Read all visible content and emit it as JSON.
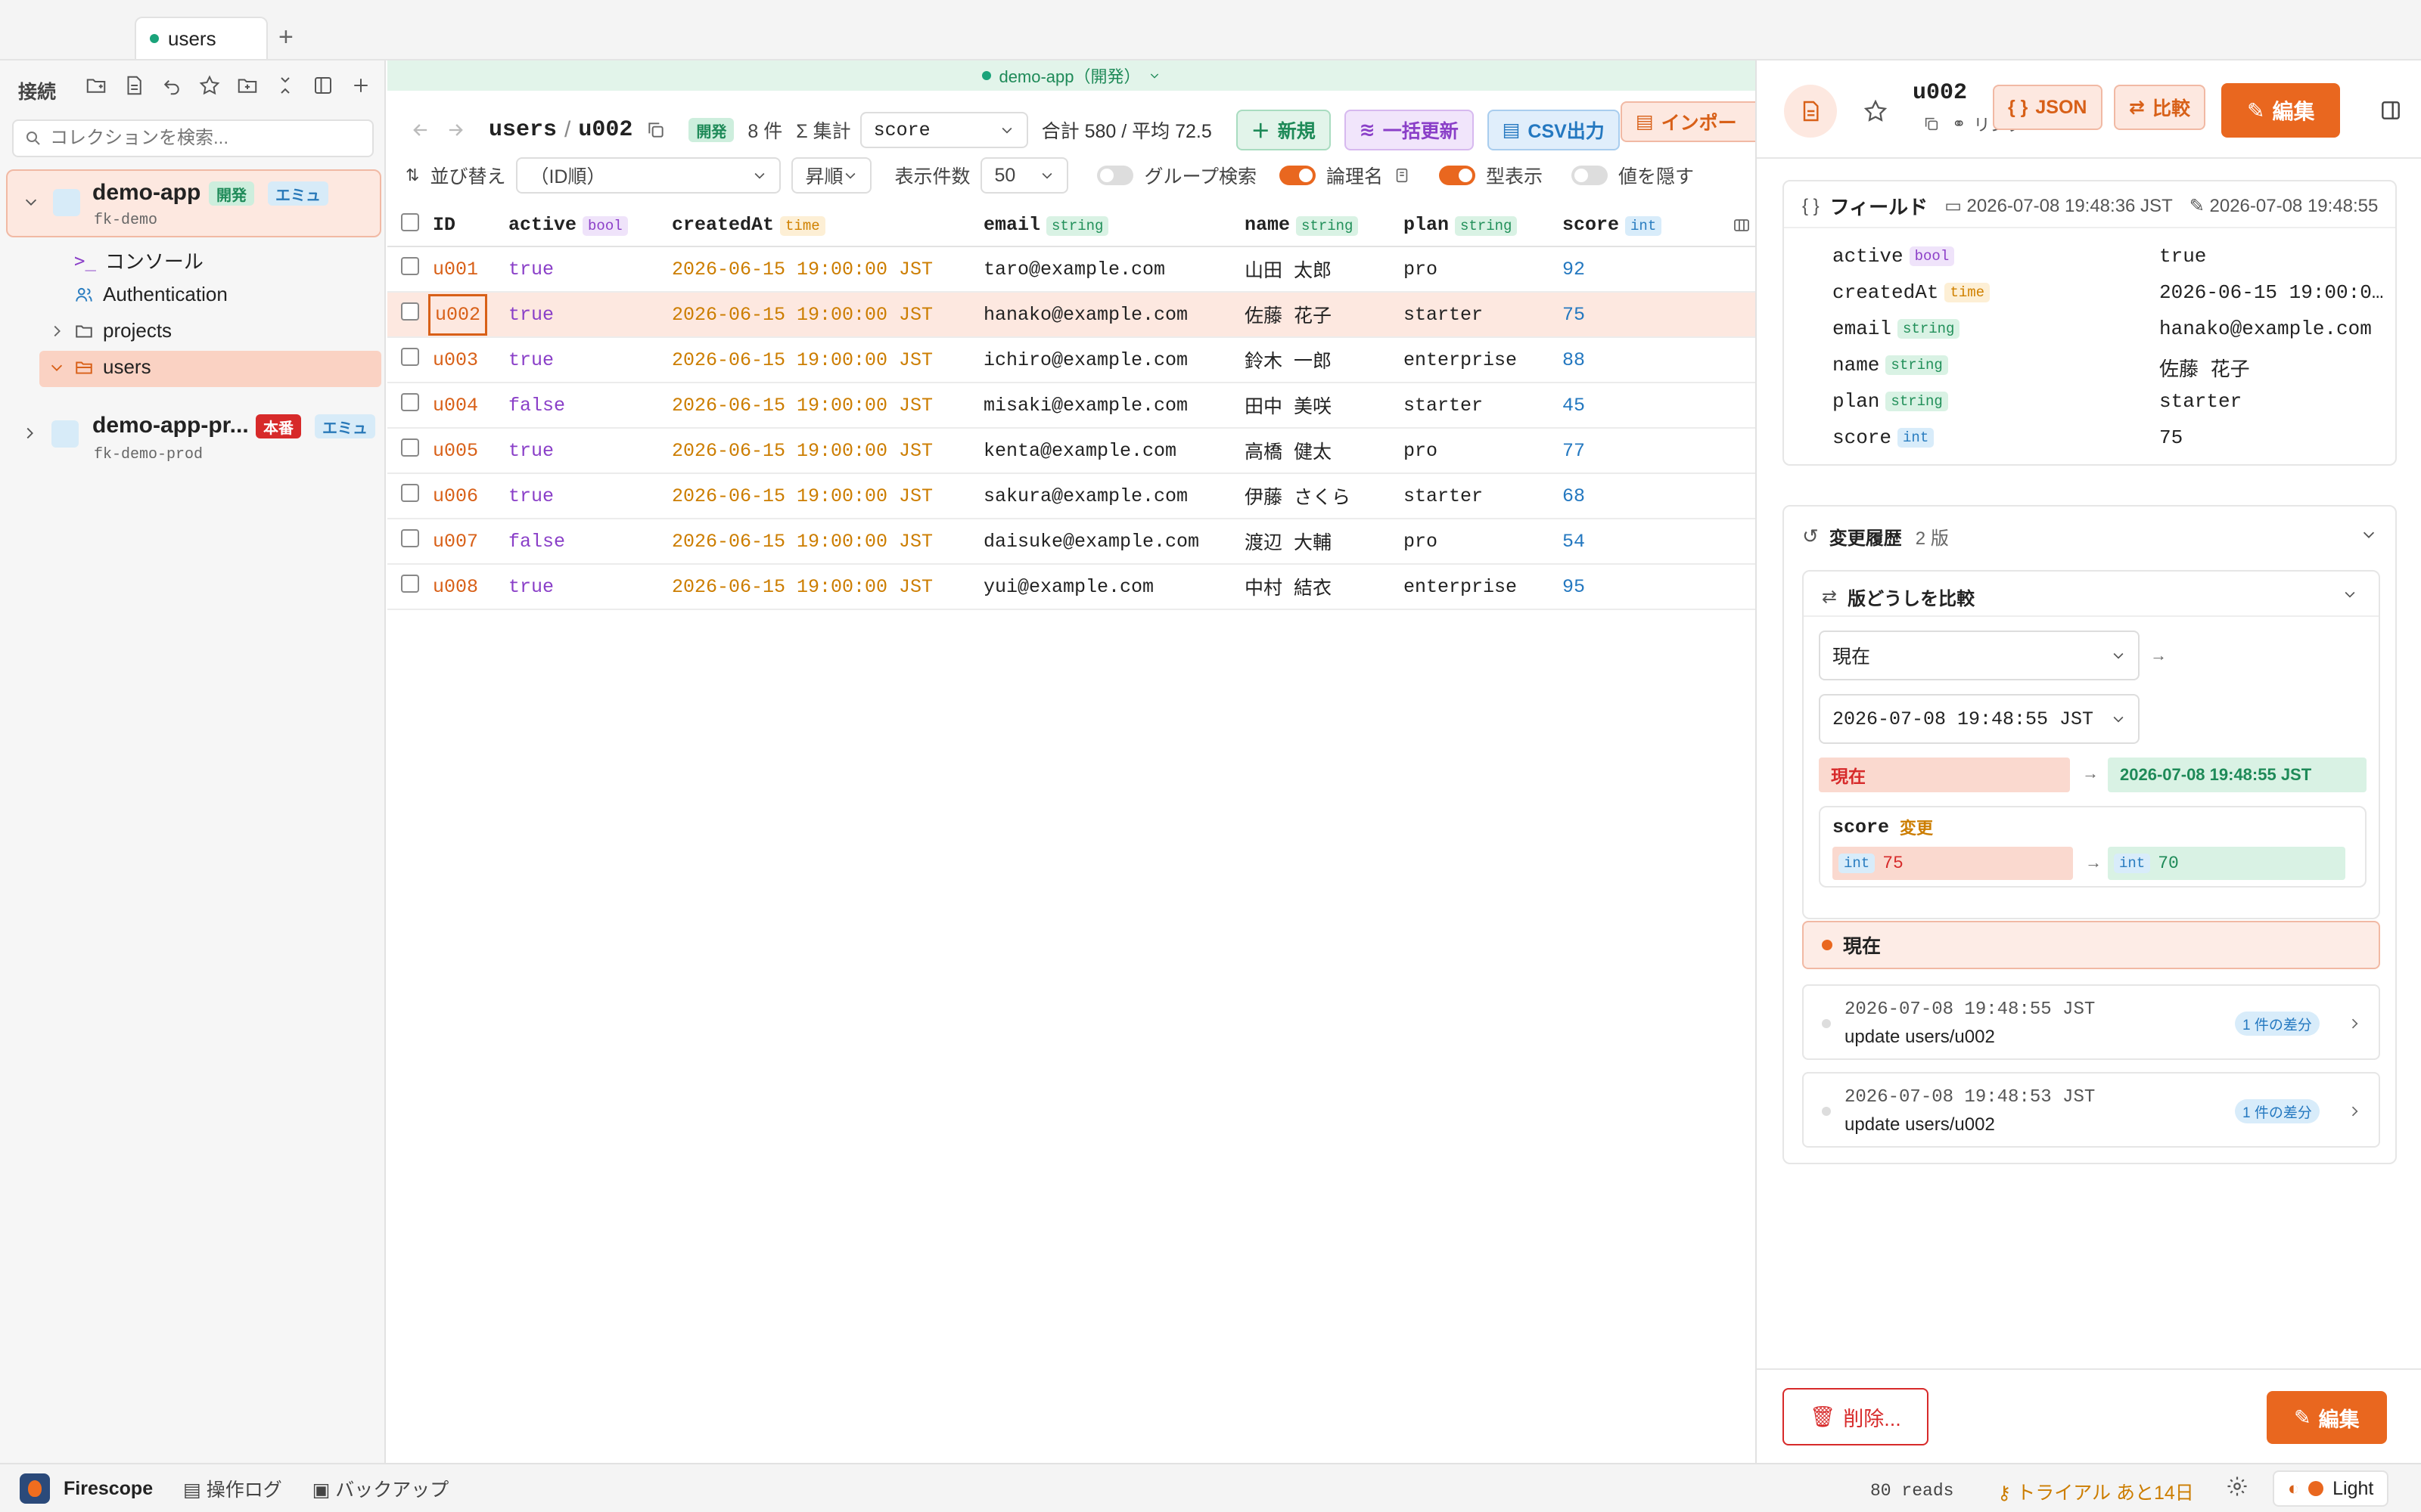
{
  "tabs": [
    {
      "label": "users"
    }
  ],
  "sidebar": {
    "title": "接続",
    "search_placeholder": "コレクションを検索...",
    "connections": [
      {
        "name": "demo-app",
        "project": "fk-demo",
        "env": "開発",
        "mode": "エミュ",
        "children": [
          {
            "label": "コンソール"
          },
          {
            "label": "Authentication"
          },
          {
            "label": "projects"
          },
          {
            "label": "users"
          }
        ]
      },
      {
        "name": "demo-app-pr...",
        "project": "fk-demo-prod",
        "env": "本番",
        "mode": "エミュ"
      }
    ]
  },
  "env_banner": "demo-app（開発）",
  "toolbar": {
    "path_collection": "users",
    "path_sep": "/",
    "path_doc": "u002",
    "env_badge": "開発",
    "count": "8 件",
    "agg_label": "集計",
    "agg_field": "score",
    "agg_result": "合計 580 / 平均 72.5",
    "new_label": "新規",
    "bulk_label": "一括更新",
    "csv_label": "CSV出力",
    "import_label": "インポー"
  },
  "filterbar": {
    "sort_label": "並び替え",
    "sort_value": "（ID順）",
    "order_value": "昇順",
    "page_size_label": "表示件数",
    "page_size": "50",
    "group_search_label": "グループ検索",
    "group_search": false,
    "logical_name_label": "論理名",
    "logical_name": true,
    "type_display_label": "型表示",
    "type_display": true,
    "hide_values_label": "値を隠す",
    "hide_values": false
  },
  "table": {
    "columns": [
      {
        "name": "ID",
        "type": ""
      },
      {
        "name": "active",
        "type": "bool"
      },
      {
        "name": "createdAt",
        "type": "time"
      },
      {
        "name": "email",
        "type": "string"
      },
      {
        "name": "name",
        "type": "string"
      },
      {
        "name": "plan",
        "type": "string"
      },
      {
        "name": "score",
        "type": "int"
      }
    ],
    "rows": [
      {
        "id": "u001",
        "active": "true",
        "createdAt": "2026-06-15 19:00:00 JST",
        "email": "taro@example.com",
        "name": "山田 太郎",
        "plan": "pro",
        "score": "92"
      },
      {
        "id": "u002",
        "active": "true",
        "createdAt": "2026-06-15 19:00:00 JST",
        "email": "hanako@example.com",
        "name": "佐藤 花子",
        "plan": "starter",
        "score": "75"
      },
      {
        "id": "u003",
        "active": "true",
        "createdAt": "2026-06-15 19:00:00 JST",
        "email": "ichiro@example.com",
        "name": "鈴木 一郎",
        "plan": "enterprise",
        "score": "88"
      },
      {
        "id": "u004",
        "active": "false",
        "createdAt": "2026-06-15 19:00:00 JST",
        "email": "misaki@example.com",
        "name": "田中 美咲",
        "plan": "starter",
        "score": "45"
      },
      {
        "id": "u005",
        "active": "true",
        "createdAt": "2026-06-15 19:00:00 JST",
        "email": "kenta@example.com",
        "name": "高橋 健太",
        "plan": "pro",
        "score": "77"
      },
      {
        "id": "u006",
        "active": "true",
        "createdAt": "2026-06-15 19:00:00 JST",
        "email": "sakura@example.com",
        "name": "伊藤 さくら",
        "plan": "starter",
        "score": "68"
      },
      {
        "id": "u007",
        "active": "false",
        "createdAt": "2026-06-15 19:00:00 JST",
        "email": "daisuke@example.com",
        "name": "渡辺 大輔",
        "plan": "pro",
        "score": "54"
      },
      {
        "id": "u008",
        "active": "true",
        "createdAt": "2026-06-15 19:00:00 JST",
        "email": "yui@example.com",
        "name": "中村 結衣",
        "plan": "enterprise",
        "score": "95"
      }
    ],
    "selected_row": "u002"
  },
  "detail": {
    "doc_id": "u002",
    "link_label": "リンク",
    "json_label": "JSON",
    "compare_label": "比較",
    "edit_label": "編集",
    "fields_title": "フィールド",
    "created": "2026-07-08 19:48:36 JST",
    "updated": "2026-07-08 19:48:55",
    "fields": [
      {
        "key": "active",
        "type": "bool",
        "value": "true"
      },
      {
        "key": "createdAt",
        "type": "time",
        "value": "2026-06-15 19:00:0…"
      },
      {
        "key": "email",
        "type": "string",
        "value": "hanako@example.com"
      },
      {
        "key": "name",
        "type": "string",
        "value": "佐藤 花子"
      },
      {
        "key": "plan",
        "type": "string",
        "value": "starter"
      },
      {
        "key": "score",
        "type": "int",
        "value": "75"
      }
    ],
    "history_title": "変更履歴",
    "history_count": "2 版",
    "compare_title": "版どうしを比較",
    "compare_from": "現在",
    "compare_to": "2026-07-08 19:48:55 JST",
    "diff_from_label": "現在",
    "diff_to_label": "2026-07-08 19:48:55 JST",
    "diff_field": "score",
    "diff_change": "変更",
    "diff_old_type": "int",
    "diff_old": "75",
    "diff_new_type": "int",
    "diff_new": "70",
    "current_label": "現在",
    "versions": [
      {
        "time": "2026-07-08 19:48:55 JST",
        "desc": "update users/u002",
        "badge": "1 件の差分"
      },
      {
        "time": "2026-07-08 19:48:53 JST",
        "desc": "update users/u002",
        "badge": "1 件の差分"
      }
    ],
    "delete_label": "削除...",
    "edit_bottom_label": "編集"
  },
  "statusbar": {
    "app": "Firescope",
    "oplog": "操作ログ",
    "backup": "バックアップ",
    "reads": "80 reads",
    "trial": "トライアル あと14日",
    "theme": "Light"
  },
  "colors": {
    "accent": "#e9671f",
    "dev": "#1e8a58",
    "prod": "#d72a2a"
  }
}
